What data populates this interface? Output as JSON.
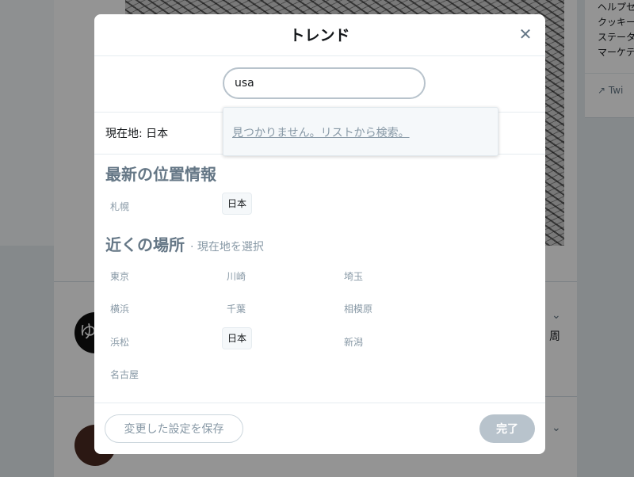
{
  "background": {
    "right_panel_lines": [
      "ヘルプセ",
      "クッキー",
      "ステータ",
      "マーケテ"
    ],
    "right_panel_footer": "Twi",
    "avatar1_glyph": "ゆ",
    "feed_week_char": "周"
  },
  "modal": {
    "title": "トレンド",
    "close_icon": "close-icon",
    "search": {
      "value": "usa",
      "placeholder": ""
    },
    "dropdown_message": "見つかりません。リストから検索。",
    "current_location": "現在地: 日本",
    "recent": {
      "title": "最新の位置情報",
      "items": [
        {
          "label": "札幌",
          "selected": false
        },
        {
          "label": "日本",
          "selected": true
        }
      ]
    },
    "nearby": {
      "title": "近くの場所",
      "subtitle": "· 現在地を選択",
      "items": [
        {
          "label": "東京",
          "selected": false
        },
        {
          "label": "川崎",
          "selected": false
        },
        {
          "label": "埼玉",
          "selected": false
        },
        {
          "label": "横浜",
          "selected": false
        },
        {
          "label": "千葉",
          "selected": false
        },
        {
          "label": "相模原",
          "selected": false
        },
        {
          "label": "浜松",
          "selected": false
        },
        {
          "label": "日本",
          "selected": true
        },
        {
          "label": "新潟",
          "selected": false
        },
        {
          "label": "名古屋",
          "selected": false
        }
      ]
    },
    "footer": {
      "save_label": "変更した設定を保存",
      "done_label": "完了"
    }
  },
  "colors": {
    "overlay": "#000000",
    "muted_text": "#8899a6",
    "heading_text": "#657786",
    "disabled_button": "#b8c3cc"
  }
}
